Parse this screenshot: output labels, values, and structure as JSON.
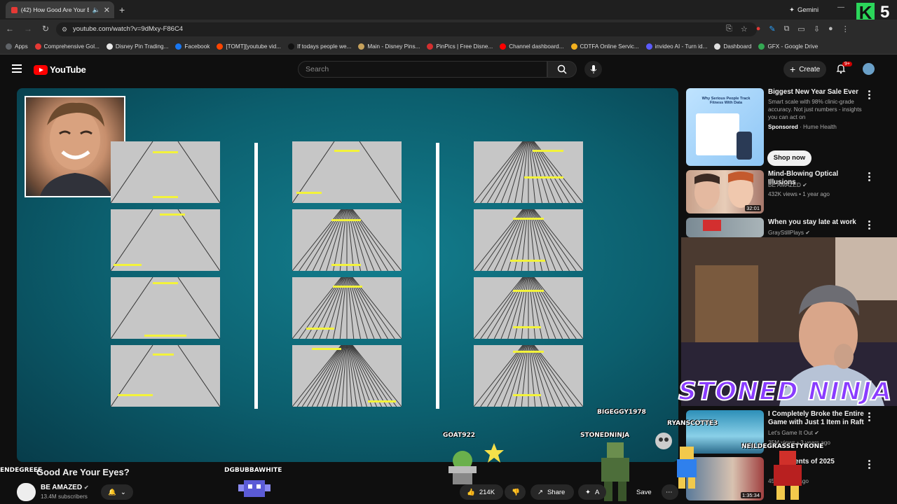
{
  "browser": {
    "tab_title": "(42) How Good Are Your Ey",
    "new_tab_symbol": "+",
    "gemini_label": "Gemini",
    "url": "youtube.com/watch?v=9dMxy-F86C4",
    "overlay_k": "K",
    "overlay_num": "5",
    "bookmarks": [
      {
        "label": "Apps",
        "color": "#5f6368"
      },
      {
        "label": "Comprehensive Gol...",
        "color": "#e53935"
      },
      {
        "label": "Disney Pin Trading...",
        "color": "#e8e8e8"
      },
      {
        "label": "Facebook",
        "color": "#1877f2"
      },
      {
        "label": "[TOMT][youtube vid...",
        "color": "#ff4500"
      },
      {
        "label": "If todays people we...",
        "color": "#111111"
      },
      {
        "label": "Main - Disney Pins...",
        "color": "#c6a15b"
      },
      {
        "label": "PinPics | Free Disne...",
        "color": "#d32f2f"
      },
      {
        "label": "Channel dashboard...",
        "color": "#ff0000"
      },
      {
        "label": "CDTFA Online Servic...",
        "color": "#f2b01e"
      },
      {
        "label": "invideo AI - Turn id...",
        "color": "#5b5bff"
      },
      {
        "label": "Dashboard",
        "color": "#e0e0e0"
      },
      {
        "label": "GFX - Google Drive",
        "color": "#34a853"
      }
    ]
  },
  "youtube": {
    "logo_text": "YouTube",
    "search_placeholder": "Search",
    "create_label": "Create",
    "notif_badge": "9+"
  },
  "sidebar_recs": [
    {
      "title": "Biggest New Year Sale Ever",
      "desc": "Smart scale with 98% clinic-grade accuracy. Not just numbers - insights you can act on",
      "sponsored": "Sponsored",
      "advertiser": "Hume Health",
      "cta": "Shop now"
    },
    {
      "title": "Mind-Blowing Optical Illusions",
      "channel": "BE AMAZED",
      "meta": "432K views • 1 year ago",
      "duration": "32:01"
    },
    {
      "title": "When you stay late at work",
      "channel": "GrayStillPlays"
    },
    {
      "title": "I Completely Broke the Entire Game with Just 1 Item in Raft",
      "channel": "Let's Game It Out",
      "meta": "35M views • 3 years ago"
    },
    {
      "title": "...ents of 2025",
      "meta": "45K • ...day ago",
      "duration": "1:35:34"
    }
  ],
  "ad_thumb_text": "Why Serious People Track Fitness With Data",
  "stream_overlay": {
    "banner": "STONED NINJA",
    "chatters": [
      "BIGEGGY1978",
      "RYANSCOTTE3",
      "NEILDEGRASSETYRONE",
      "GOAT922",
      "STONEDNINJA",
      "DGBUBBAWHITE",
      "ENDEGREEE"
    ]
  },
  "video": {
    "title": "Good Are Your Eyes?",
    "channel": "BE AMAZED",
    "subscribers": "13.4M subscribers",
    "likes": "214K",
    "share_label": "Share",
    "ask_label": "A",
    "save_label": "Save"
  }
}
